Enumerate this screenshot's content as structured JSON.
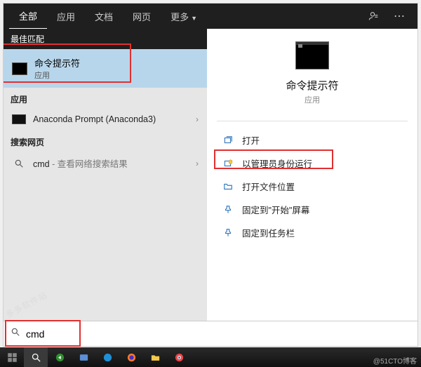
{
  "tabs": {
    "all": "全部",
    "apps": "应用",
    "docs": "文档",
    "web": "网页",
    "more": "更多"
  },
  "sections": {
    "best_match": "最佳匹配",
    "apps": "应用",
    "web": "搜索网页"
  },
  "best_match": {
    "title": "命令提示符",
    "subtitle": "应用"
  },
  "apps_list": {
    "anaconda": "Anaconda Prompt (Anaconda3)"
  },
  "web_list": {
    "cmd_label": "cmd",
    "cmd_sub": " - 查看网络搜索结果"
  },
  "preview": {
    "title": "命令提示符",
    "subtitle": "应用"
  },
  "actions": {
    "open": "打开",
    "run_admin": "以管理员身份运行",
    "open_location": "打开文件位置",
    "pin_start": "固定到\"开始\"屏幕",
    "pin_taskbar": "固定到任务栏"
  },
  "search": {
    "value": "cmd",
    "placeholder": ""
  },
  "watermarks": {
    "bottom_right": "@51CTO博客",
    "bottom_left": "多多软件站"
  },
  "colors": {
    "highlight_red": "#e03030",
    "selection_blue": "#b8d6eb",
    "action_icon": "#3a7bbf"
  }
}
